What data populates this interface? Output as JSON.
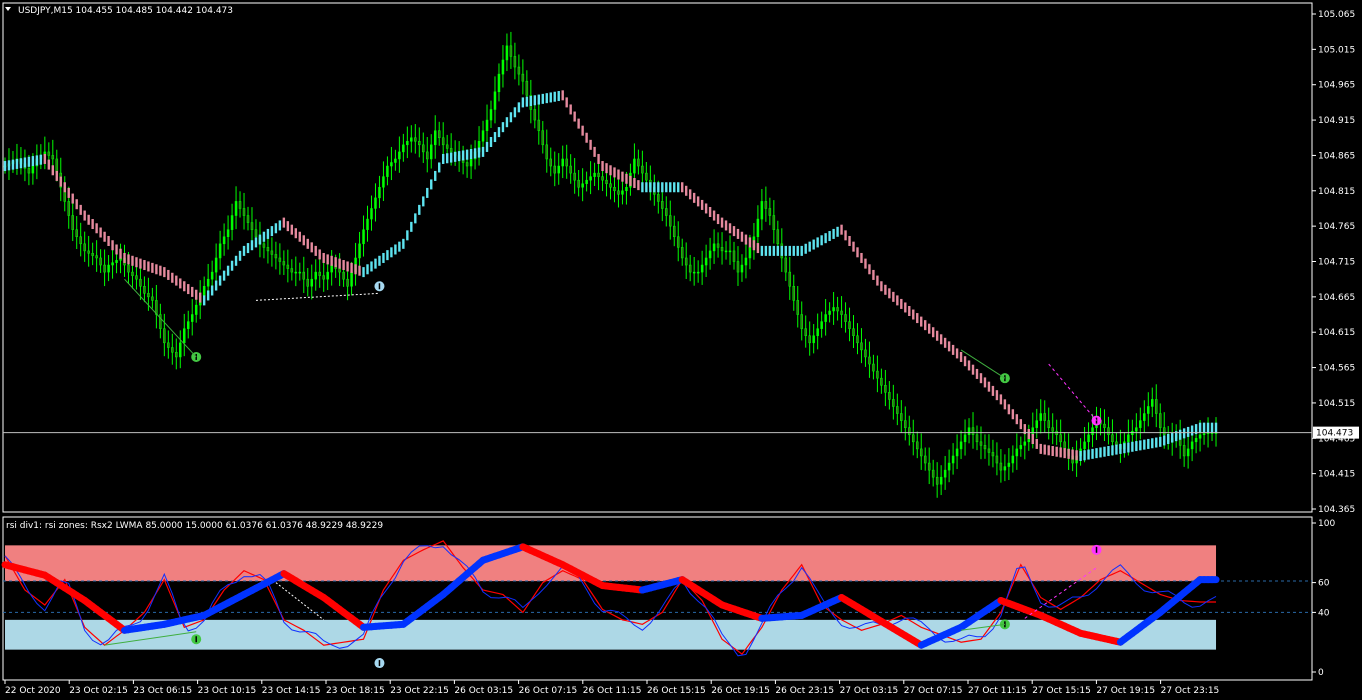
{
  "header": {
    "symbol_line": "USDJPY,M15  104.455 104.485 104.442 104.473"
  },
  "indicator_header": "rsi div1: rsi zones: Rsx2 LWMA 85.0000 15.0000 61.0376 61.0376 48.9229 48.9229",
  "colors": {
    "background": "#000000",
    "frame": "#ffffff",
    "candle": "#00ff00",
    "candle_shadow": "#2e7d14",
    "ma_up": "#5ee4f0",
    "ma_down": "#e58a9e",
    "rsi_fast": "#ff0000",
    "rsi_slow_up": "#0033ff",
    "rsi_slow_down": "#ff0000",
    "zone_high": "#f08080",
    "zone_low": "#add8e6",
    "level_line": "#2a6aa8",
    "price_line": "#c0c0c0"
  },
  "chart_data": [
    {
      "type": "line",
      "chart": "price",
      "title": "USDJPY,M15",
      "ohlc_shown": {
        "open": 104.455,
        "high": 104.485,
        "low": 104.442,
        "close": 104.473
      },
      "current_price_label": "104.473",
      "current_price": 104.473,
      "ylim": [
        104.365,
        105.065
      ],
      "y_ticks": [
        "105.065",
        "105.015",
        "104.965",
        "104.915",
        "104.865",
        "104.815",
        "104.765",
        "104.715",
        "104.665",
        "104.615",
        "104.565",
        "104.515",
        "104.465",
        "104.415",
        "104.365"
      ],
      "y_tick_values": [
        105.065,
        105.015,
        104.965,
        104.915,
        104.865,
        104.815,
        104.765,
        104.715,
        104.665,
        104.615,
        104.565,
        104.515,
        104.465,
        104.415,
        104.365
      ],
      "x_labels": [
        "22 Oct 2020",
        "23 Oct 02:15",
        "23 Oct 06:15",
        "23 Oct 10:15",
        "23 Oct 14:15",
        "23 Oct 18:15",
        "23 Oct 22:15",
        "26 Oct 03:15",
        "26 Oct 07:15",
        "26 Oct 11:15",
        "26 Oct 15:15",
        "26 Oct 19:15",
        "26 Oct 23:15",
        "27 Oct 03:15",
        "27 Oct 07:15",
        "27 Oct 11:15",
        "27 Oct 15:15",
        "27 Oct 19:15",
        "27 Oct 23:15"
      ],
      "series": [
        {
          "name": "",
          "kind": "price_close",
          "x_index": [
            0,
            3,
            6,
            8,
            10,
            12,
            14,
            17,
            20,
            23,
            25,
            26,
            29,
            31,
            33,
            35,
            37,
            40,
            43,
            45,
            47,
            50,
            52,
            54,
            56,
            58,
            60,
            62,
            64,
            66,
            68,
            70,
            72,
            74,
            76,
            78,
            80,
            82,
            84,
            86,
            88,
            90,
            92,
            94,
            96,
            98,
            100,
            102,
            104,
            106,
            108,
            110,
            112,
            114,
            116,
            118,
            120,
            122,
            124,
            126,
            128,
            130,
            132,
            134,
            136,
            138,
            140,
            142,
            144,
            146,
            148,
            150,
            152,
            154,
            156,
            158,
            160,
            162,
            164,
            166,
            168,
            170,
            172,
            174,
            176,
            178,
            180,
            182,
            184,
            186,
            188,
            190,
            192,
            194,
            196,
            198,
            200,
            202,
            204,
            206,
            208,
            210,
            212,
            214,
            216,
            218,
            220,
            222,
            224,
            226,
            228,
            230,
            232,
            234,
            236,
            238,
            240,
            242,
            244,
            246,
            248,
            250,
            252,
            254,
            256,
            258,
            260,
            262,
            264,
            266,
            268,
            270,
            272,
            274,
            276,
            278,
            280,
            282,
            284,
            286,
            288,
            290,
            292,
            294,
            296,
            298,
            300,
            302
          ],
          "values": [
            104.85,
            104.86,
            104.84,
            104.86,
            104.87,
            104.86,
            104.82,
            104.76,
            104.73,
            104.72,
            104.7,
            104.71,
            104.72,
            104.7,
            104.69,
            104.67,
            104.66,
            104.6,
            104.58,
            104.62,
            104.64,
            104.68,
            104.7,
            104.74,
            104.76,
            104.8,
            104.78,
            104.76,
            104.74,
            104.73,
            104.72,
            104.71,
            104.7,
            104.7,
            104.68,
            104.7,
            104.69,
            104.71,
            104.7,
            104.68,
            104.72,
            104.76,
            104.79,
            104.82,
            104.85,
            104.86,
            104.88,
            104.89,
            104.88,
            104.86,
            104.9,
            104.88,
            104.87,
            104.86,
            104.85,
            104.87,
            104.9,
            104.93,
            104.98,
            105.02,
            104.99,
            104.97,
            104.93,
            104.9,
            104.86,
            104.84,
            104.86,
            104.84,
            104.82,
            104.83,
            104.84,
            104.83,
            104.82,
            104.81,
            104.82,
            104.86,
            104.84,
            104.82,
            104.8,
            104.78,
            104.75,
            104.72,
            104.7,
            104.7,
            104.72,
            104.74,
            104.73,
            104.73,
            104.7,
            104.72,
            104.75,
            104.8,
            104.78,
            104.74,
            104.7,
            104.66,
            104.62,
            104.6,
            104.62,
            104.64,
            104.65,
            104.64,
            104.62,
            104.6,
            104.58,
            104.56,
            104.54,
            104.52,
            104.5,
            104.48,
            104.46,
            104.44,
            104.42,
            104.4,
            104.42,
            104.44,
            104.46,
            104.48,
            104.46,
            104.45,
            104.44,
            104.42,
            104.43,
            104.45,
            104.46,
            104.48,
            104.5,
            104.48,
            104.47,
            104.45,
            104.43,
            104.45,
            104.47,
            104.49,
            104.48,
            104.46,
            104.45,
            104.47,
            104.48,
            104.5,
            104.52,
            104.48,
            104.46,
            104.47,
            104.44,
            104.46,
            104.47,
            104.473
          ]
        },
        {
          "name": "",
          "kind": "moving_average",
          "x_index": [
            0,
            10,
            20,
            30,
            40,
            50,
            60,
            70,
            80,
            90,
            100,
            110,
            120,
            130,
            140,
            150,
            160,
            170,
            180,
            190,
            200,
            210,
            220,
            230,
            240,
            250,
            260,
            270,
            280,
            290,
            300
          ],
          "values": [
            104.85,
            104.86,
            104.78,
            104.72,
            104.7,
            104.66,
            104.73,
            104.77,
            104.72,
            104.7,
            104.74,
            104.86,
            104.87,
            104.94,
            104.95,
            104.85,
            104.82,
            104.82,
            104.77,
            104.73,
            104.73,
            104.76,
            104.68,
            104.63,
            104.58,
            104.52,
            104.45,
            104.44,
            104.45,
            104.46,
            104.48
          ]
        }
      ],
      "markers": [
        {
          "type": "divergence",
          "label": "bullish",
          "x_index": 48,
          "price": 104.58
        },
        {
          "type": "divergence",
          "label": "bullish",
          "x_index": 94,
          "price": 104.68
        },
        {
          "type": "divergence",
          "label": "bullish",
          "x_index": 251,
          "price": 104.55
        },
        {
          "type": "divergence",
          "label": "bearish",
          "x_index": 274,
          "price": 104.49
        }
      ]
    },
    {
      "type": "line",
      "chart": "rsi",
      "title": "rsi div1: rsi zones: Rsx2 LWMA 85.0000 15.0000 61.0376 61.0376 48.9229 48.9229",
      "ylim": [
        0,
        100
      ],
      "y_ticks": [
        "100",
        "60",
        "40",
        "0"
      ],
      "y_tick_values": [
        100,
        60,
        40,
        0
      ],
      "levels": [
        61.0376,
        40
      ],
      "zones": [
        {
          "name": "high",
          "from": 61,
          "to": 85
        },
        {
          "name": "low",
          "from": 15,
          "to": 35
        }
      ],
      "series": [
        {
          "name": "Rsx2",
          "kind": "fast",
          "x_index": [
            0,
            5,
            10,
            15,
            20,
            25,
            30,
            35,
            40,
            45,
            50,
            55,
            60,
            65,
            70,
            75,
            80,
            85,
            90,
            95,
            100,
            105,
            110,
            115,
            120,
            125,
            130,
            135,
            140,
            145,
            150,
            155,
            160,
            165,
            170,
            175,
            180,
            185,
            190,
            195,
            200,
            205,
            210,
            215,
            220,
            225,
            230,
            235,
            240,
            245,
            250,
            255,
            260,
            265,
            270,
            275,
            280,
            285,
            290,
            295,
            300
          ],
          "values": [
            78,
            55,
            45,
            62,
            30,
            18,
            28,
            40,
            62,
            30,
            35,
            55,
            68,
            62,
            35,
            28,
            18,
            20,
            22,
            55,
            75,
            82,
            88,
            70,
            55,
            52,
            40,
            60,
            68,
            62,
            42,
            35,
            32,
            40,
            62,
            48,
            22,
            12,
            30,
            55,
            72,
            45,
            35,
            28,
            32,
            38,
            30,
            25,
            20,
            22,
            40,
            72,
            50,
            42,
            50,
            62,
            68,
            60,
            52,
            48,
            47
          ]
        },
        {
          "name": "LWMA",
          "kind": "slow",
          "x_index": [
            0,
            10,
            20,
            30,
            40,
            50,
            60,
            70,
            80,
            90,
            100,
            110,
            120,
            130,
            140,
            150,
            160,
            170,
            180,
            190,
            200,
            210,
            220,
            230,
            240,
            250,
            260,
            270,
            280,
            290,
            300
          ],
          "values": [
            72,
            65,
            48,
            28,
            32,
            38,
            52,
            66,
            50,
            30,
            32,
            52,
            75,
            84,
            72,
            58,
            55,
            62,
            45,
            36,
            38,
            50,
            34,
            18,
            30,
            48,
            38,
            26,
            20,
            40,
            62
          ]
        }
      ]
    }
  ]
}
